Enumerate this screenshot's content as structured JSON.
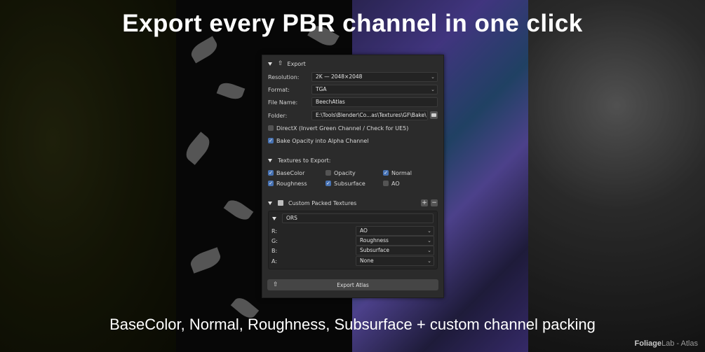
{
  "headline": "Export every PBR channel in one click",
  "footline": "BaseColor, Normal, Roughness, Subsurface + custom channel packing",
  "watermark": {
    "brand_bold": "Foliage",
    "brand_rest": "Lab - Atlas"
  },
  "panel": {
    "header": "Export",
    "resolution": {
      "label": "Resolution:",
      "value": "2K — 2048×2048"
    },
    "format": {
      "label": "Format:",
      "value": "TGA"
    },
    "file_name": {
      "label": "File Name:",
      "value": "BeechAtlas"
    },
    "folder": {
      "label": "Folder:",
      "value": "E:\\Tools\\Blender\\Co...as\\Textures\\GF\\Bake\\"
    },
    "directx": {
      "label": "DirectX (Invert Green Channel / Check for UE5)",
      "checked": false
    },
    "bake_opacity": {
      "label": "Bake Opacity into Alpha Channel",
      "checked": true
    },
    "textures_section": "Textures to Export:",
    "textures": [
      {
        "label": "BaseColor",
        "checked": true
      },
      {
        "label": "Opacity",
        "checked": false
      },
      {
        "label": "Normal",
        "checked": true
      },
      {
        "label": "Roughness",
        "checked": true
      },
      {
        "label": "Subsurface",
        "checked": true
      },
      {
        "label": "AO",
        "checked": false
      }
    ],
    "custom_section": "Custom Packed Textures",
    "packed": {
      "name": "ORS",
      "channels": [
        {
          "label": "R:",
          "value": "AO"
        },
        {
          "label": "G:",
          "value": "Roughness"
        },
        {
          "label": "B:",
          "value": "Subsurface"
        },
        {
          "label": "A:",
          "value": "None"
        }
      ]
    },
    "export_button": "Export Atlas"
  },
  "colors": {
    "accent": "#4772b3",
    "panel": "#2b2b2b"
  }
}
